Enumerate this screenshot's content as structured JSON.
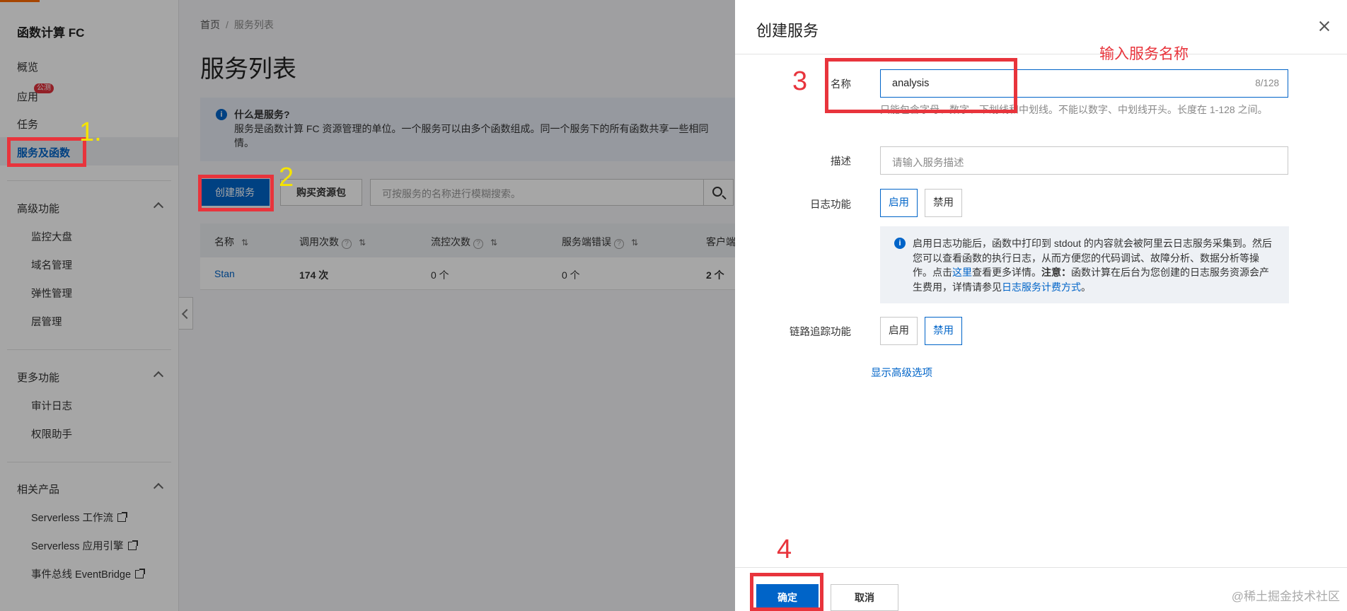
{
  "sidebar": {
    "brand": "函数计算 FC",
    "items": [
      {
        "label": "概览"
      },
      {
        "label": "应用",
        "badge": "公测"
      },
      {
        "label": "任务"
      },
      {
        "label": "服务及函数"
      }
    ],
    "groups": [
      {
        "title": "高级功能",
        "items": [
          "监控大盘",
          "域名管理",
          "弹性管理",
          "层管理"
        ]
      },
      {
        "title": "更多功能",
        "items": [
          "审计日志",
          "权限助手"
        ]
      },
      {
        "title": "相关产品",
        "items": [
          "Serverless 工作流",
          "Serverless 应用引擎",
          "事件总线 EventBridge"
        ]
      }
    ]
  },
  "main": {
    "breadcrumb": {
      "home": "首页",
      "separator": "/",
      "current": "服务列表"
    },
    "title": "服务列表",
    "notice": {
      "title": "什么是服务?",
      "body": "服务是函数计算 FC 资源管理的单位。一个服务可以由多个函数组成。同一个服务下的所有函数共享一些相同",
      "body_tail": "情。"
    },
    "create_button": "创建服务",
    "buy_button": "购买资源包",
    "search_placeholder": "可按服务的名称进行模糊搜索。",
    "table": {
      "columns": [
        "名称",
        "调用次数",
        "流控次数",
        "服务端错误",
        "客户端"
      ],
      "rows": [
        {
          "name": "Stan",
          "calls": "174 次",
          "throttled": "0 个",
          "server_errors": "0 个",
          "client": "2 个"
        }
      ]
    }
  },
  "drawer": {
    "title": "创建服务",
    "name_label": "名称",
    "name_value": "analysis",
    "name_counter": "8/128",
    "name_hint": "只能包含字母、数字、下划线和中划线。不能以数字、中划线开头。长度在 1-128 之间。",
    "desc_label": "描述",
    "desc_placeholder": "请输入服务描述",
    "log_label": "日志功能",
    "enable": "启用",
    "disable": "禁用",
    "log_info": {
      "p1": "启用日志功能后，函数中打印到 stdout 的内容就会被阿里云日志服务采集到。然后您可以查看函数的执行日志，从而方便您的代码调试、故障分析、数据分析等操作。点击",
      "link1": "这里",
      "p2": "查看更多详情。",
      "strong": "注意：",
      "p3": "函数计算在后台为您创建的日志服务资源会产生费用，详情请参见",
      "link2": "日志服务计费方式",
      "p4": "。"
    },
    "trace_label": "链路追踪功能",
    "advanced_link": "显示高级选项",
    "confirm": "确定",
    "cancel": "取消"
  },
  "annotations": {
    "step1": "1.",
    "step2": "2",
    "step3": "3",
    "step4": "4",
    "step3_text": "输入服务名称",
    "color_red": "#e8343c",
    "color_yellow": "#f5e400"
  },
  "watermark": "@稀土掘金技术社区"
}
